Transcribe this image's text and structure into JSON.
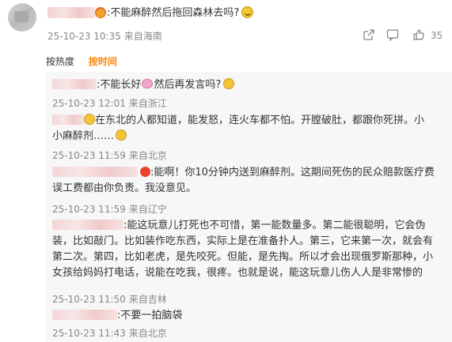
{
  "main_comment": {
    "text": ":不能麻醉然后拖回森林去吗?",
    "timestamp": "25-10-23 10:35",
    "location": "来自海南",
    "likes": "35"
  },
  "sort": {
    "hot": "按热度",
    "time": "按时间"
  },
  "replies": [
    {
      "text": ":不能长好",
      "text2": "然后再发言吗?",
      "timestamp": "25-10-23 12:01",
      "location": "来自浙江"
    },
    {
      "text": "在东北的人都知道，能发怒，连火车都不怕。开膛破肚，都跟你死拼。小",
      "line2": "小麻醉剂……",
      "timestamp": "25-10-23 11:59",
      "location": "来自北京"
    },
    {
      "text": ":能啊！你10分钟内送到麻醉剂。这期间死伤的民众赔款医疗费",
      "line2": "误工费都由你负责。我没意见。",
      "timestamp": "25-10-23 11:59",
      "location": "来自辽宁"
    },
    {
      "text": ":能这玩意儿打死也不可惜，第一能数量多。第二能很聪明，它会伪",
      "line2": "装，比如敲门。比如装作吃东西，实际上是在准备扑人。第三，它来第一次，就会有",
      "line3": "第二次。第四，比如老虎，是先咬死。但能，是先掏。所以才会出现俄罗斯那种，小",
      "line4": "女孩给妈妈打电话，说能在吃我，很疼。也就是说，能这玩意儿伤人人是非常惨的",
      "timestamp": "25-10-23 11:50",
      "location": "来自吉林"
    },
    {
      "text": ":不要一拍脑袋",
      "timestamp": "25-10-23 11:43",
      "location": "来自北京"
    }
  ]
}
